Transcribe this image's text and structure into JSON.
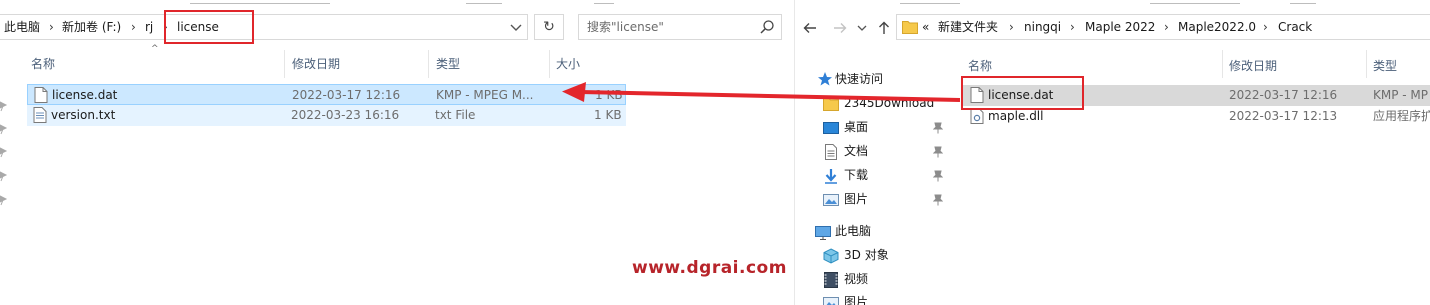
{
  "left_window": {
    "breadcrumb": [
      "此电脑",
      "新加卷 (F:)",
      "rj",
      "license"
    ],
    "search_placeholder": "搜索\"license\"",
    "columns": [
      "名称",
      "修改日期",
      "类型",
      "大小"
    ],
    "files": [
      {
        "name": "license.dat",
        "modified": "2022-03-17 12:16",
        "type": "KMP - MPEG M...",
        "size": "1 KB",
        "state": "selected"
      },
      {
        "name": "version.txt",
        "modified": "2022-03-23 16:16",
        "type": "txt File",
        "size": "1 KB",
        "state": "hover"
      }
    ]
  },
  "right_window": {
    "breadcrumb_prefix": "«",
    "breadcrumb": [
      "新建文件夹",
      "ningqi",
      "Maple 2022",
      "Maple2022.0",
      "Crack"
    ],
    "columns": [
      "名称",
      "修改日期",
      "类型"
    ],
    "files": [
      {
        "name": "license.dat",
        "modified": "2022-03-17 12:16",
        "type": "KMP - MP",
        "state": "selected"
      },
      {
        "name": "maple.dll",
        "modified": "2022-03-17 12:13",
        "type": "应用程序扩",
        "state": "normal"
      }
    ],
    "nav_tree": {
      "quick_access": "快速访问",
      "quick_items": [
        "2345Download",
        "桌面",
        "文档",
        "下载",
        "图片"
      ],
      "this_pc": "此电脑",
      "pc_items": [
        "3D 对象",
        "视频",
        "图片"
      ]
    }
  },
  "watermark": "www.dgrai.com",
  "colors": {
    "selected_row": "#cce8ff",
    "hover_row": "#e5f3ff",
    "highlight_red": "#e0262b",
    "folder_yellow": "#f6c94b",
    "header_text": "#4c607a"
  }
}
